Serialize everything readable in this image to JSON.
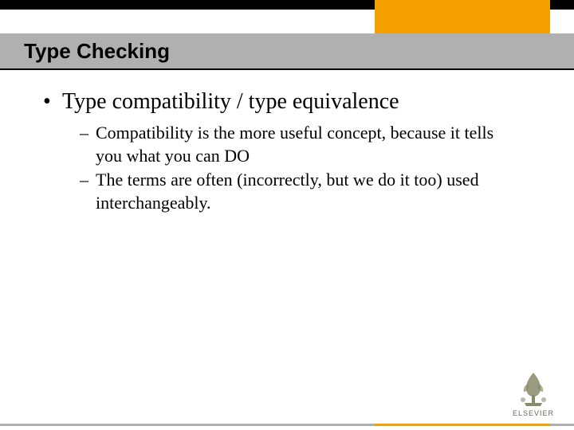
{
  "header": {
    "title": "Type Checking"
  },
  "content": {
    "main_bullet": "Type compatibility / type equivalence",
    "sub_bullets": [
      "Compatibility is the more useful concept, because it tells you what you can DO",
      "The terms are often (incorrectly, but we do it too) used interchangeably."
    ]
  },
  "footer": {
    "publisher": "ELSEVIER"
  },
  "colors": {
    "accent_orange": "#f4a000",
    "title_bg": "#b0b0b0"
  }
}
